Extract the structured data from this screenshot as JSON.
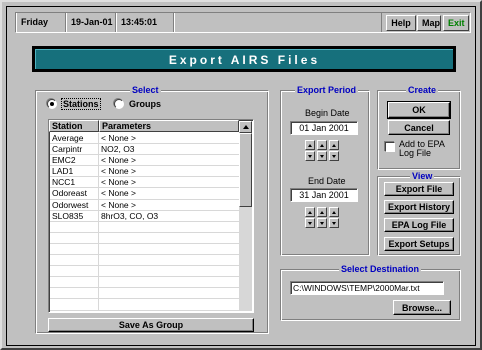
{
  "status": {
    "day": "Friday",
    "date": "19-Jan-01",
    "time": "13:45:01",
    "help_label": "Help",
    "map_label": "Map",
    "exit_label": "Exit",
    "exit_color": "#008000"
  },
  "banner": {
    "title": "Export AIRS Files",
    "color": "#1a7a86"
  },
  "select": {
    "title": "Select",
    "stations_label": "Stations",
    "groups_label": "Groups",
    "selected": "Stations",
    "columns": [
      "Station",
      "Parameters"
    ],
    "rows": [
      {
        "station": "Average",
        "parameters": "< None >"
      },
      {
        "station": "Carpintr",
        "parameters": "NO2, O3"
      },
      {
        "station": "EMC2",
        "parameters": "< None >"
      },
      {
        "station": "LAD1",
        "parameters": "< None >"
      },
      {
        "station": "NCC1",
        "parameters": "< None >"
      },
      {
        "station": "Odoreast",
        "parameters": "< None >"
      },
      {
        "station": "Odorwest",
        "parameters": "< None >"
      },
      {
        "station": "SLO835",
        "parameters": "8hrO3, CO, O3"
      }
    ],
    "empty_rows": 8,
    "save_group_label": "Save As Group"
  },
  "export_period": {
    "title": "Export Period",
    "begin_label": "Begin Date",
    "begin_value": "01 Jan 2001",
    "end_label": "End Date",
    "end_value": "31 Jan 2001"
  },
  "create": {
    "title": "Create",
    "ok_label": "OK",
    "cancel_label": "Cancel",
    "add_epa_label_1": "Add to EPA",
    "add_epa_label_2": "Log File",
    "add_epa_checked": false
  },
  "view": {
    "title": "View",
    "buttons": [
      "Export File",
      "Export History",
      "EPA Log File",
      "Export Setups"
    ]
  },
  "destination": {
    "title": "Select Destination",
    "path": "C:\\WINDOWS\\TEMP\\2000Mar.txt",
    "browse_label": "Browse..."
  },
  "accent_color": "#0000c0"
}
